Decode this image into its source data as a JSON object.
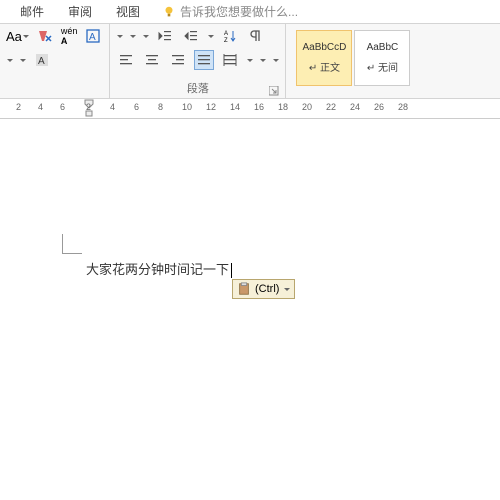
{
  "tabs": {
    "mail": "邮件",
    "review": "审阅",
    "view": "视图"
  },
  "tell_me": "告诉我您想要做什么...",
  "paragraph_label": "段落",
  "styles": {
    "s1_sample": "AaBbCcD",
    "s1_name": "↵ 正文",
    "s2_sample": "AaBbC",
    "s2_name": "↵ 无间"
  },
  "ruler": [
    "6",
    "4",
    "2",
    "2",
    "4",
    "6",
    "8",
    "10",
    "12",
    "14",
    "16",
    "18",
    "20",
    "22",
    "24",
    "26",
    "28"
  ],
  "document_text": "大家花两分钟时间记一下",
  "paste_ctrl": "(Ctrl)"
}
